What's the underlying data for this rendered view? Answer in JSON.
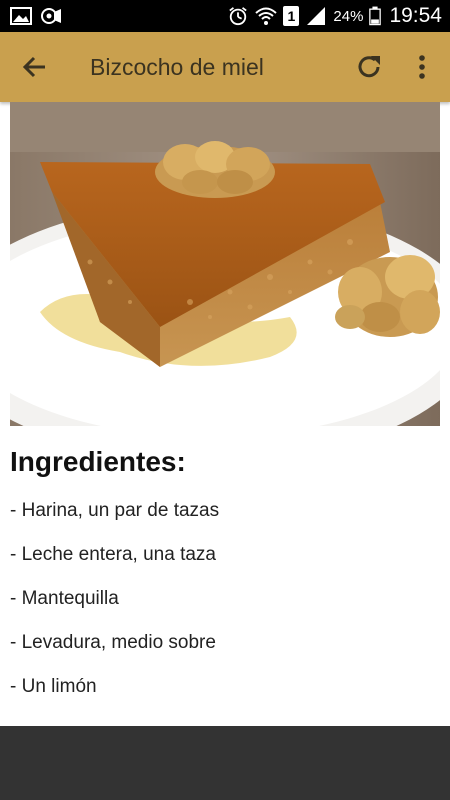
{
  "status_bar": {
    "battery_percent": "24%",
    "sim_label": "1",
    "time": "19:54"
  },
  "app_bar": {
    "title": "Bizcocho de miel",
    "back_icon": "arrow-left-icon",
    "refresh_icon": "refresh-icon",
    "more_icon": "more-vertical-icon",
    "background_color": "#c9a04e"
  },
  "recipe": {
    "section_title": "Ingredientes:",
    "ingredients": [
      "- Harina, un par de tazas",
      "- Leche entera, una taza",
      "- Mantequilla",
      "- Levadura, medio sobre",
      "- Un limón"
    ]
  }
}
